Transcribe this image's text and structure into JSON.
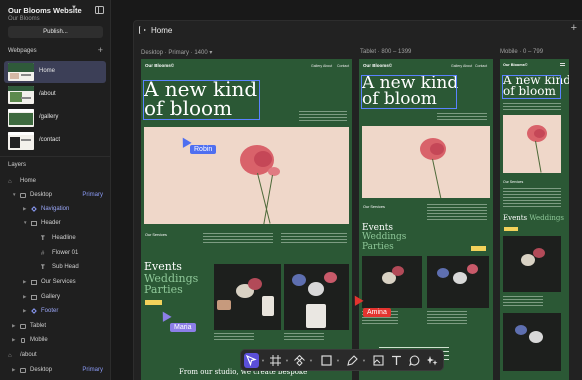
{
  "site": {
    "name": "Our Blooms Website",
    "subtitle": "Our Blooms",
    "publish_label": "Publish..."
  },
  "webpages": {
    "heading": "Webpages",
    "items": [
      {
        "label": "Home",
        "active": true
      },
      {
        "label": "/about",
        "active": false
      },
      {
        "label": "/gallery",
        "active": false
      },
      {
        "label": "/contact",
        "active": false
      }
    ]
  },
  "layers": {
    "heading": "Layers",
    "rows": [
      {
        "label": "Home",
        "icon": "home-icon",
        "depth": 0
      },
      {
        "label": "Desktop",
        "icon": "monitor-icon",
        "depth": 1,
        "badge": "Primary"
      },
      {
        "label": "Navigation",
        "icon": "component-icon",
        "depth": 2,
        "component": true
      },
      {
        "label": "Header",
        "icon": "grid-icon",
        "depth": 2
      },
      {
        "label": "Headline",
        "icon": "text-icon",
        "depth": 3
      },
      {
        "label": "Flower 01",
        "icon": "frame-icon",
        "depth": 3
      },
      {
        "label": "Sub Head",
        "icon": "text-icon",
        "depth": 3
      },
      {
        "label": "Our Services",
        "icon": "grid-icon",
        "depth": 2
      },
      {
        "label": "Gallery",
        "icon": "grid-icon",
        "depth": 2
      },
      {
        "label": "Footer",
        "icon": "component-icon",
        "depth": 2,
        "component": true
      },
      {
        "label": "Tablet",
        "icon": "tablet-icon",
        "depth": 1
      },
      {
        "label": "Mobile",
        "icon": "mobile-icon",
        "depth": 1
      },
      {
        "label": "/about",
        "icon": "home-icon",
        "depth": 0
      },
      {
        "label": "Desktop",
        "icon": "monitor-icon",
        "depth": 1,
        "badge": "Primary"
      }
    ]
  },
  "canvas": {
    "page_title": "Home",
    "breakpoints": [
      {
        "label": "Desktop · Primary · 1400 ▾"
      },
      {
        "label": "Tablet · 800 – 1399"
      },
      {
        "label": "Mobile · 0 – 799"
      }
    ]
  },
  "preview": {
    "logo": "Our Blooms©",
    "nav": [
      "Gallery",
      "About",
      "Contact"
    ],
    "hero_line1": "A new kind",
    "hero_line2": "of bloom",
    "services_label": "Our Services",
    "events_line1": "Events",
    "events_line2": "Weddings",
    "events_line3": "Parties",
    "footer_text": "From our studio, we create bespoke"
  },
  "collaborators": [
    {
      "name": "Robin",
      "color": "#4f6ff0"
    },
    {
      "name": "Amina",
      "color": "#e3342f"
    },
    {
      "name": "Maria",
      "color": "#8c7ee8"
    }
  ],
  "colors": {
    "frame_green": "#2b5835",
    "accent": "#5b4fd9",
    "selection": "#5a82ff"
  },
  "toolbar": {
    "tools": [
      "pointer-tool",
      "frame-tool",
      "component-tool",
      "shape-tool",
      "pen-tool",
      "image-tool",
      "text-tool",
      "comment-tool",
      "ai-tool"
    ]
  }
}
